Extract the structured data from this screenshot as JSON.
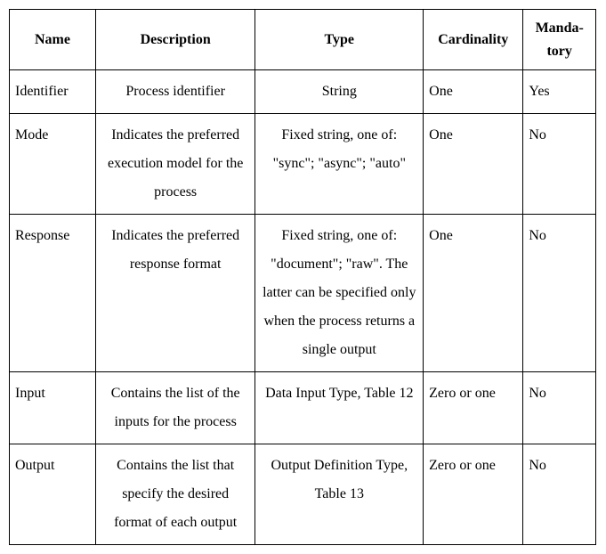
{
  "headers": {
    "name": "Name",
    "description": "Description",
    "type": "Type",
    "cardinality": "Cardinality",
    "mandatory": "Manda-\ntory"
  },
  "rows": [
    {
      "name": "Identifier",
      "description": "Process identifier",
      "type": "String",
      "cardinality": "One",
      "mandatory": "Yes"
    },
    {
      "name": "Mode",
      "description": "Indicates the preferred execution model for the process",
      "type": "Fixed string, one of: \"sync\"; \"async\"; \"auto\"",
      "cardinality": "One",
      "mandatory": "No"
    },
    {
      "name": "Response",
      "description": "Indicates the preferred response format",
      "type": "Fixed string, one of: \"document\"; \"raw\". The latter can be specified only when the process returns a single output",
      "cardinality": "One",
      "mandatory": "No"
    },
    {
      "name": "Input",
      "description": "Contains the list of the inputs for the process",
      "type": "Data Input Type, Table 12",
      "cardinality": "Zero or one",
      "mandatory": "No"
    },
    {
      "name": "Output",
      "description": "Contains the list that specify the desired format of each output",
      "type": "Output Definition Type, Table 13",
      "cardinality": "Zero or one",
      "mandatory": "No"
    }
  ]
}
